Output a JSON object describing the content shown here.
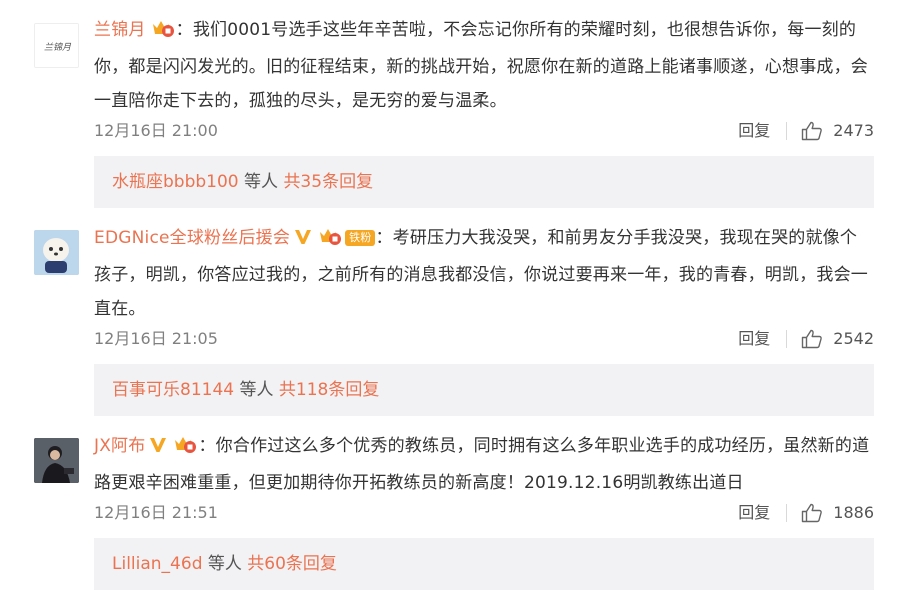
{
  "comments": [
    {
      "username": "兰锦月",
      "avatar_text": "兰锦月",
      "text": "我们0001号选手这些年辛苦啦，不会忘记你所有的荣耀时刻，也很想告诉你，每一刻的你，都是闪闪发光的。旧的征程结束，新的挑战开始，祝愿你在新的道路上能诸事顺遂，心想事成，会一直陪你走下去的，孤独的尽头，是无穷的爱与温柔。",
      "time": "12月16日 21:00",
      "reply_label": "回复",
      "likes": "2473",
      "replies_user": "水瓶座bbbb100",
      "replies_mid": "等人",
      "replies_count": "共35条回复"
    },
    {
      "username": "EDGNice全球粉丝后援会",
      "fan_badge": "铁粉",
      "text": "考研压力大我没哭，和前男友分手我没哭，我现在哭的就像个孩子，明凯，你答应过我的，之前所有的消息我都没信，你说过要再来一年，我的青春，明凯，我会一直在。",
      "time": "12月16日 21:05",
      "reply_label": "回复",
      "likes": "2542",
      "replies_user": "百事可乐81144",
      "replies_mid": "等人",
      "replies_count": "共118条回复"
    },
    {
      "username": "JX阿布",
      "text": "你合作过这么多个优秀的教练员，同时拥有这么多年职业选手的成功经历，虽然新的道路更艰辛困难重重，但更加期待你开拓教练员的新高度！2019.12.16明凯教练出道日",
      "time": "12月16日 21:51",
      "reply_label": "回复",
      "likes": "1886",
      "replies_user": "Lillian_46d",
      "replies_mid": "等人",
      "replies_count": "共60条回复"
    }
  ],
  "separator": "：",
  "colors": {
    "link": "#eb7350",
    "verified": "#f5a623",
    "reply_bg": "#f2f2f5"
  },
  "icons": {
    "like": "thumbs-up-icon",
    "verified": "verified-v-icon",
    "member": "member-crown-icon"
  }
}
